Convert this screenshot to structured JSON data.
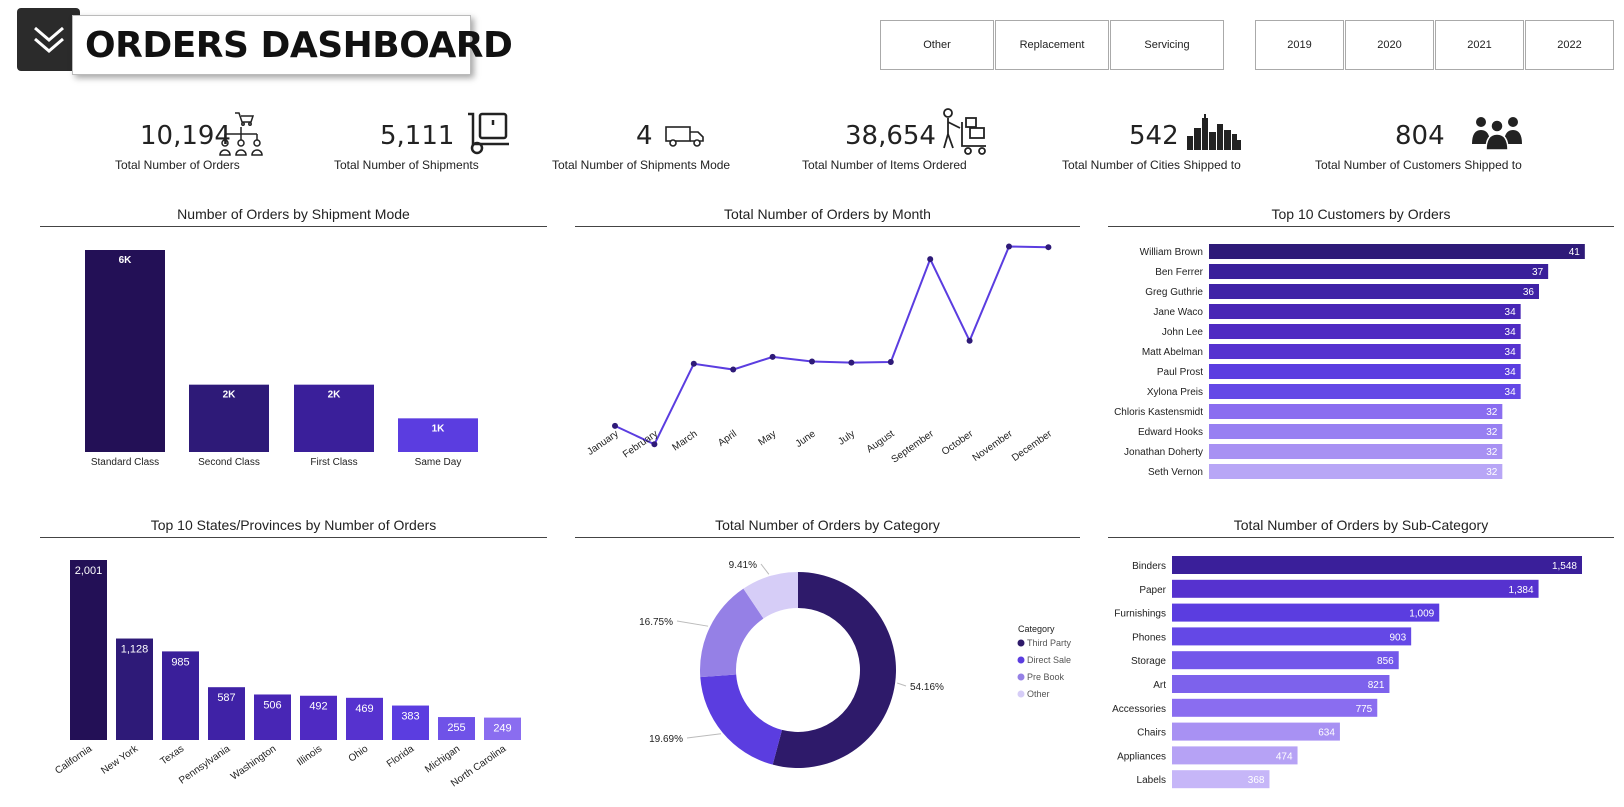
{
  "header": {
    "title": "ORDERS DASHBOARD",
    "category_slicer": [
      "Other",
      "Replacement",
      "Servicing"
    ],
    "year_slicer": [
      "2019",
      "2020",
      "2021",
      "2022"
    ]
  },
  "kpis": [
    {
      "value": "10,194",
      "label": "Total Number of Orders",
      "icon": "cart-network-icon"
    },
    {
      "value": "5,111",
      "label": "Total Number of Shipments",
      "icon": "hand-truck-icon"
    },
    {
      "value": "4",
      "label": "Total Number of Shipments Mode",
      "icon": "delivery-truck-icon"
    },
    {
      "value": "38,654",
      "label": "Total Number of Items Ordered",
      "icon": "worker-cart-icon"
    },
    {
      "value": "542",
      "label": "Total Number of Cities Shipped to",
      "icon": "city-skyline-icon"
    },
    {
      "value": "804",
      "label": "Total Number of Customers Shipped to",
      "icon": "people-group-icon"
    }
  ],
  "colors": {
    "darkest": "#231056",
    "dark": "#2e1a78",
    "mid_dark": "#3a1f9a",
    "mid": "#4b2fc0",
    "bright": "#5b3de0",
    "light": "#8a6df0",
    "lighter": "#a891f3",
    "lightest": "#c6b6f8"
  },
  "chart_data": [
    {
      "type": "bar",
      "title": "Number of Orders by Shipment Mode",
      "categories": [
        "Standard Class",
        "Second Class",
        "First Class",
        "Same Day"
      ],
      "values": [
        6000,
        2000,
        2000,
        1000
      ],
      "value_labels": [
        "6K",
        "2K",
        "2K",
        "1K"
      ],
      "colors": [
        "#231056",
        "#2e1a78",
        "#3a1f9a",
        "#5b3de0"
      ],
      "ylim": [
        0,
        6000
      ]
    },
    {
      "type": "line",
      "title": "Total Number of Orders by Month",
      "categories": [
        "January",
        "February",
        "March",
        "April",
        "May",
        "June",
        "July",
        "August",
        "September",
        "October",
        "November",
        "December"
      ],
      "values": [
        470,
        390,
        740,
        715,
        770,
        750,
        745,
        748,
        1195,
        840,
        1250,
        1247
      ],
      "ylim": [
        300,
        1300
      ],
      "color": "#5b3de0"
    },
    {
      "type": "bar",
      "orientation": "horizontal",
      "title": "Top 10 Customers by Orders",
      "categories": [
        "William Brown",
        "Ben Ferrer",
        "Greg Guthrie",
        "Jane Waco",
        "John Lee",
        "Matt Abelman",
        "Paul Prost",
        "Xylona Preis",
        "Chloris Kastensmidt",
        "Edward Hooks",
        "Jonathan Doherty",
        "Seth Vernon"
      ],
      "values": [
        41,
        37,
        36,
        34,
        34,
        34,
        34,
        34,
        32,
        32,
        32,
        32
      ],
      "colors": [
        "#2e1a78",
        "#3a1f9a",
        "#3f22a6",
        "#4826b5",
        "#4f2ac2",
        "#5632cf",
        "#5b3de0",
        "#6448e6",
        "#8a6df0",
        "#9880f2",
        "#a891f3",
        "#b8a6f6"
      ],
      "xlim": [
        0,
        42
      ]
    },
    {
      "type": "bar",
      "title": "Top 10 States/Provinces by Number of Orders",
      "categories": [
        "California",
        "New York",
        "Texas",
        "Pennsylvania",
        "Washington",
        "Illinois",
        "Ohio",
        "Florida",
        "Michigan",
        "North Carolina"
      ],
      "values": [
        2001,
        1128,
        985,
        587,
        506,
        492,
        469,
        383,
        255,
        249
      ],
      "value_labels": [
        "2,001",
        "1,128",
        "985",
        "587",
        "506",
        "492",
        "469",
        "383",
        "255",
        "249"
      ],
      "colors": [
        "#231056",
        "#2e1a78",
        "#3a1f9a",
        "#3f22a6",
        "#4826b5",
        "#4f2ac2",
        "#5632cf",
        "#5b3de0",
        "#6f52e8",
        "#8a6df0"
      ],
      "ylim": [
        0,
        2001
      ]
    },
    {
      "type": "pie",
      "donut": true,
      "title": "Total Number of Orders by Category",
      "legend_title": "Category",
      "labels": [
        "Third Party",
        "Direct Sale",
        "Pre Book",
        "Other"
      ],
      "values": [
        54.16,
        19.69,
        16.75,
        9.41
      ],
      "value_labels": [
        "54.16%",
        "19.69%",
        "16.75%",
        "9.41%"
      ],
      "colors": [
        "#2e1a6a",
        "#5b3de0",
        "#9580e6",
        "#d6cdf7"
      ]
    },
    {
      "type": "bar",
      "orientation": "horizontal",
      "title": "Total Number of Orders by Sub-Category",
      "categories": [
        "Binders",
        "Paper",
        "Furnishings",
        "Phones",
        "Storage",
        "Art",
        "Accessories",
        "Chairs",
        "Appliances",
        "Labels"
      ],
      "values": [
        1548,
        1384,
        1009,
        903,
        856,
        821,
        775,
        634,
        474,
        368
      ],
      "value_labels": [
        "1,548",
        "1,384",
        "1,009",
        "903",
        "856",
        "821",
        "775",
        "634",
        "474",
        "368"
      ],
      "colors": [
        "#3a1f9a",
        "#5632cf",
        "#5b3de0",
        "#6448e6",
        "#7357ea",
        "#7d62ec",
        "#8a6df0",
        "#a891f3",
        "#b6a2f5",
        "#c6b6f8"
      ],
      "xlim": [
        0,
        1548
      ]
    }
  ]
}
